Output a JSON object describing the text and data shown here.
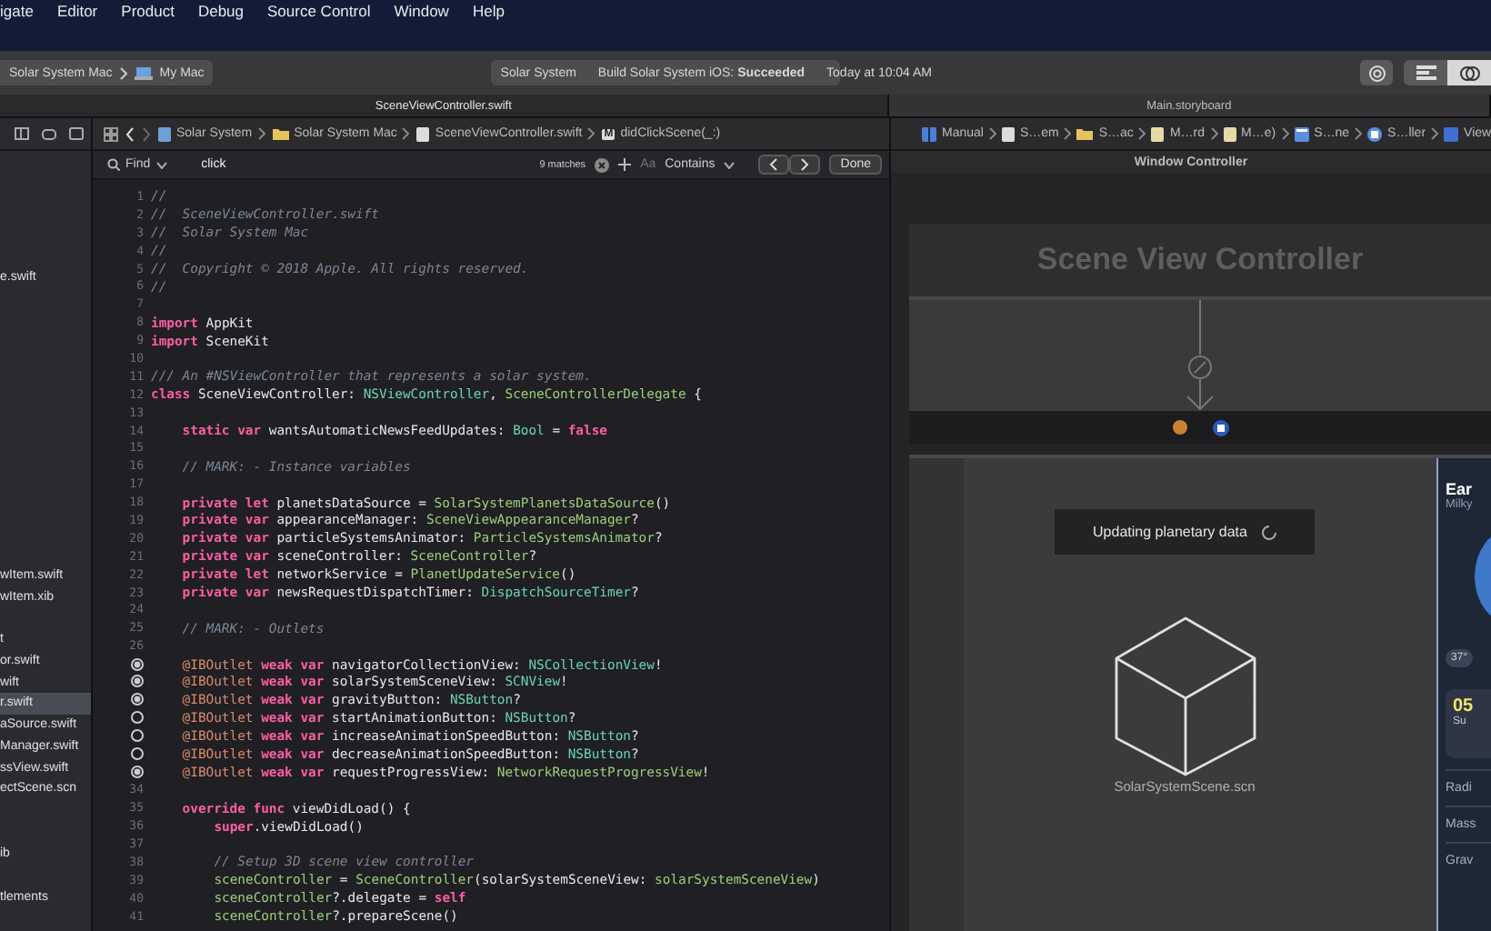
{
  "menu_bar": {
    "items": [
      "igate",
      "Editor",
      "Product",
      "Debug",
      "Source Control",
      "Window",
      "Help"
    ]
  },
  "toolbar": {
    "scheme": {
      "target": "Solar System Mac",
      "destination": "My Mac"
    },
    "activity": {
      "project": "Solar System",
      "status": "Build Solar System iOS: **Succeeded**",
      "time": "Today at 10:04 AM"
    },
    "view_buttons": [
      {
        "kind": "library",
        "selected": false
      },
      {
        "kind": "editor",
        "selected": false
      },
      {
        "kind": "assistant",
        "selected": true
      }
    ]
  },
  "tabs": [
    {
      "label": "SceneViewController.swift",
      "selected": true
    },
    {
      "label": "Main.storyboard",
      "selected": false
    }
  ],
  "navigator": {
    "sections": [
      [
        "e.swift"
      ],
      [
        "wItem.swift",
        "wItem.xib"
      ],
      [
        "t",
        "or.swift",
        "wift",
        {
          "label": "r.swift",
          "selected": true
        },
        "aSource.swift",
        "Manager.swift",
        "ssView.swift",
        "ectScene.scn"
      ],
      [
        "ib"
      ],
      [
        "tlements"
      ]
    ]
  },
  "editor": {
    "jump_bar": [
      {
        "label": "Solar System",
        "kind": "project"
      },
      {
        "label": "Solar System Mac",
        "kind": "folder"
      },
      {
        "label": "SceneViewController.swift",
        "kind": "file"
      },
      {
        "label": "didClickScene(_:)",
        "kind": "method",
        "badge": "M"
      }
    ],
    "find_bar": {
      "mode": "Find",
      "query": "click",
      "matches": "9 matches",
      "case_button": "Aa",
      "match_mode": "Contains",
      "done": "Done"
    },
    "lines": [
      {
        "number": "1",
        "kind": "top",
        "tokens": [
          {
            "kind": "comment",
            "text": "//"
          }
        ]
      },
      {
        "number": "2",
        "kind": "top",
        "tokens": [
          {
            "kind": "comment",
            "text": "//  SceneViewController.swift"
          }
        ]
      },
      {
        "number": "3",
        "kind": "top",
        "tokens": [
          {
            "kind": "comment",
            "text": "//  Solar System Mac"
          }
        ]
      },
      {
        "number": "4",
        "kind": "top",
        "tokens": [
          {
            "kind": "comment",
            "text": "//"
          }
        ]
      },
      {
        "number": "5",
        "kind": "top",
        "tokens": [
          {
            "kind": "comment",
            "text": "//  Copyright © 2018 Apple. All rights reserved."
          }
        ]
      },
      {
        "number": "6",
        "kind": "top",
        "tokens": [
          {
            "kind": "comment",
            "text": "//"
          }
        ]
      },
      {
        "number": "7"
      },
      {
        "number": "8",
        "kind": "top",
        "tokens": [
          {
            "kind": "keyword",
            "text": "import"
          },
          {
            "kind": "plain",
            "text": " AppKit"
          }
        ]
      },
      {
        "number": "9",
        "kind": "top",
        "tokens": [
          {
            "kind": "keyword",
            "text": "import"
          },
          {
            "kind": "plain",
            "text": " SceneKit"
          }
        ]
      },
      {
        "number": "10"
      },
      {
        "number": "11",
        "kind": "top",
        "tokens": [
          {
            "kind": "comment",
            "text": "/// An #NSViewController that represents a solar system."
          }
        ]
      },
      {
        "number": "12",
        "kind": "top",
        "tokens": [
          {
            "kind": "keyword",
            "text": "class"
          },
          {
            "kind": "plain",
            "text": " SceneViewController: "
          },
          {
            "kind": "type",
            "text": "NSViewController"
          },
          {
            "kind": "plain",
            "text": ", "
          },
          {
            "kind": "project",
            "text": "SceneControllerDelegate"
          },
          {
            "kind": "plain",
            "text": " {"
          }
        ]
      },
      {
        "number": "13"
      },
      {
        "number": "14",
        "kind": "member",
        "tokens": [
          {
            "kind": "keyword",
            "text": "static var"
          },
          {
            "kind": "plain",
            "text": " wantsAutomaticNewsFeedUpdates: "
          },
          {
            "kind": "type",
            "text": "Bool"
          },
          {
            "kind": "plain",
            "text": " = "
          },
          {
            "kind": "keyword",
            "text": "false"
          }
        ]
      },
      {
        "number": "15"
      },
      {
        "number": "16",
        "kind": "member",
        "tokens": [
          {
            "kind": "comment",
            "text": "// MARK: - Instance variables"
          }
        ]
      },
      {
        "number": "17"
      },
      {
        "number": "18",
        "kind": "member",
        "tokens": [
          {
            "kind": "keyword",
            "text": "private let"
          },
          {
            "kind": "plain",
            "text": " planetsDataSource = "
          },
          {
            "kind": "project",
            "text": "SolarSystemPlanetsDataSource"
          },
          {
            "kind": "plain",
            "text": "()"
          }
        ]
      },
      {
        "number": "19",
        "kind": "member",
        "tokens": [
          {
            "kind": "keyword",
            "text": "private var"
          },
          {
            "kind": "plain",
            "text": " appearanceManager: "
          },
          {
            "kind": "project",
            "text": "SceneViewAppearanceManager"
          },
          {
            "kind": "plain",
            "text": "?"
          }
        ]
      },
      {
        "number": "20",
        "kind": "member",
        "tokens": [
          {
            "kind": "keyword",
            "text": "private var"
          },
          {
            "kind": "plain",
            "text": " particleSystemsAnimator: "
          },
          {
            "kind": "project",
            "text": "ParticleSystemsAnimator"
          },
          {
            "kind": "plain",
            "text": "?"
          }
        ]
      },
      {
        "number": "21",
        "kind": "member",
        "tokens": [
          {
            "kind": "keyword",
            "text": "private var"
          },
          {
            "kind": "plain",
            "text": " sceneController: "
          },
          {
            "kind": "project",
            "text": "SceneController"
          },
          {
            "kind": "plain",
            "text": "?"
          }
        ]
      },
      {
        "number": "22",
        "kind": "member",
        "tokens": [
          {
            "kind": "keyword",
            "text": "private let"
          },
          {
            "kind": "plain",
            "text": " networkService = "
          },
          {
            "kind": "project",
            "text": "PlanetUpdateService"
          },
          {
            "kind": "plain",
            "text": "()"
          }
        ]
      },
      {
        "number": "23",
        "kind": "member",
        "tokens": [
          {
            "kind": "keyword",
            "text": "private var"
          },
          {
            "kind": "plain",
            "text": " newsRequestDispatchTimer: "
          },
          {
            "kind": "type",
            "text": "DispatchSourceTimer"
          },
          {
            "kind": "plain",
            "text": "?"
          }
        ]
      },
      {
        "number": "24"
      },
      {
        "number": "25",
        "kind": "member",
        "tokens": [
          {
            "kind": "comment",
            "text": "// MARK: - Outlets"
          }
        ]
      },
      {
        "number": "26"
      },
      {
        "outlet_connected": true,
        "kind": "member",
        "tokens": [
          {
            "kind": "attribute",
            "text": "@IBOutlet"
          },
          {
            "kind": "keyword",
            "text": " weak var"
          },
          {
            "kind": "plain",
            "text": " navigatorCollectionView: "
          },
          {
            "kind": "type",
            "text": "NSCollectionView"
          },
          {
            "kind": "plain",
            "text": "!"
          }
        ]
      },
      {
        "outlet_connected": true,
        "kind": "member",
        "tokens": [
          {
            "kind": "attribute",
            "text": "@IBOutlet"
          },
          {
            "kind": "keyword",
            "text": " weak var"
          },
          {
            "kind": "plain",
            "text": " solarSystemSceneView: "
          },
          {
            "kind": "type",
            "text": "SCNView"
          },
          {
            "kind": "plain",
            "text": "!"
          }
        ]
      },
      {
        "outlet_connected": true,
        "kind": "member",
        "tokens": [
          {
            "kind": "attribute",
            "text": "@IBOutlet"
          },
          {
            "kind": "keyword",
            "text": " weak var"
          },
          {
            "kind": "plain",
            "text": " gravityButton: "
          },
          {
            "kind": "type",
            "text": "NSButton"
          },
          {
            "kind": "plain",
            "text": "?"
          }
        ]
      },
      {
        "outlet_connected": false,
        "kind": "member",
        "tokens": [
          {
            "kind": "attribute",
            "text": "@IBOutlet"
          },
          {
            "kind": "keyword",
            "text": " weak var"
          },
          {
            "kind": "plain",
            "text": " startAnimationButton: "
          },
          {
            "kind": "type",
            "text": "NSButton"
          },
          {
            "kind": "plain",
            "text": "?"
          }
        ]
      },
      {
        "outlet_connected": false,
        "kind": "member",
        "tokens": [
          {
            "kind": "attribute",
            "text": "@IBOutlet"
          },
          {
            "kind": "keyword",
            "text": " weak var"
          },
          {
            "kind": "plain",
            "text": " increaseAnimationSpeedButton: "
          },
          {
            "kind": "type",
            "text": "NSButton"
          },
          {
            "kind": "plain",
            "text": "?"
          }
        ]
      },
      {
        "outlet_connected": false,
        "kind": "member",
        "tokens": [
          {
            "kind": "attribute",
            "text": "@IBOutlet"
          },
          {
            "kind": "keyword",
            "text": " weak var"
          },
          {
            "kind": "plain",
            "text": " decreaseAnimationSpeedButton: "
          },
          {
            "kind": "type",
            "text": "NSButton"
          },
          {
            "kind": "plain",
            "text": "?"
          }
        ]
      },
      {
        "outlet_connected": true,
        "kind": "member",
        "tokens": [
          {
            "kind": "attribute",
            "text": "@IBOutlet"
          },
          {
            "kind": "keyword",
            "text": " weak var"
          },
          {
            "kind": "plain",
            "text": " requestProgressView: "
          },
          {
            "kind": "project",
            "text": "NetworkRequestProgressView"
          },
          {
            "kind": "plain",
            "text": "!"
          }
        ]
      },
      {
        "number": "34"
      },
      {
        "number": "35",
        "kind": "member",
        "tokens": [
          {
            "kind": "keyword",
            "text": "override func"
          },
          {
            "kind": "plain",
            "text": " viewDidLoad() {"
          }
        ]
      },
      {
        "number": "36",
        "kind": "statement",
        "tokens": [
          {
            "kind": "keyword",
            "text": "super"
          },
          {
            "kind": "plain",
            "text": ".viewDidLoad()"
          }
        ]
      },
      {
        "number": "37"
      },
      {
        "number": "38",
        "kind": "statement",
        "tokens": [
          {
            "kind": "comment",
            "text": "// Setup 3D scene view controller"
          }
        ]
      },
      {
        "number": "39",
        "kind": "statement",
        "tokens": [
          {
            "kind": "project",
            "text": "sceneController"
          },
          {
            "kind": "plain",
            "text": " = "
          },
          {
            "kind": "project",
            "text": "SceneController"
          },
          {
            "kind": "plain",
            "text": "(solarSystemSceneView: "
          },
          {
            "kind": "project",
            "text": "solarSystemSceneView"
          },
          {
            "kind": "plain",
            "text": ")"
          }
        ]
      },
      {
        "number": "40",
        "kind": "statement",
        "tokens": [
          {
            "kind": "project",
            "text": "sceneController"
          },
          {
            "kind": "plain",
            "text": "?.delegate = "
          },
          {
            "kind": "keyword",
            "text": "self"
          }
        ]
      },
      {
        "number": "41",
        "kind": "statement",
        "tokens": [
          {
            "kind": "project",
            "text": "sceneController"
          },
          {
            "kind": "plain",
            "text": "?.prepareScene()"
          }
        ]
      }
    ]
  },
  "storyboard": {
    "jump_bar": [
      {
        "label": "Manual",
        "kind": "layout"
      },
      {
        "label": "S…em",
        "kind": "file"
      },
      {
        "label": "S…ac",
        "kind": "folder"
      },
      {
        "label": "M…rd",
        "kind": "storyboard"
      },
      {
        "label": "M…e)",
        "kind": "storyboard"
      },
      {
        "label": "S…ne",
        "kind": "scene"
      },
      {
        "label": "S…ller",
        "kind": "controller"
      },
      {
        "label": "View",
        "kind": "view"
      }
    ],
    "window_controller": "Window Controller",
    "scene_title": "Scene View Controller",
    "hud": "Updating planetary data",
    "scene_file": "SolarSystemScene.scn",
    "side_panel": {
      "title": "Ear",
      "subtitle": "Milky",
      "temperature": "37°",
      "card_value": "05",
      "card_label": "Su",
      "rows": [
        "Radi",
        "Mass",
        "Grav"
      ]
    }
  }
}
